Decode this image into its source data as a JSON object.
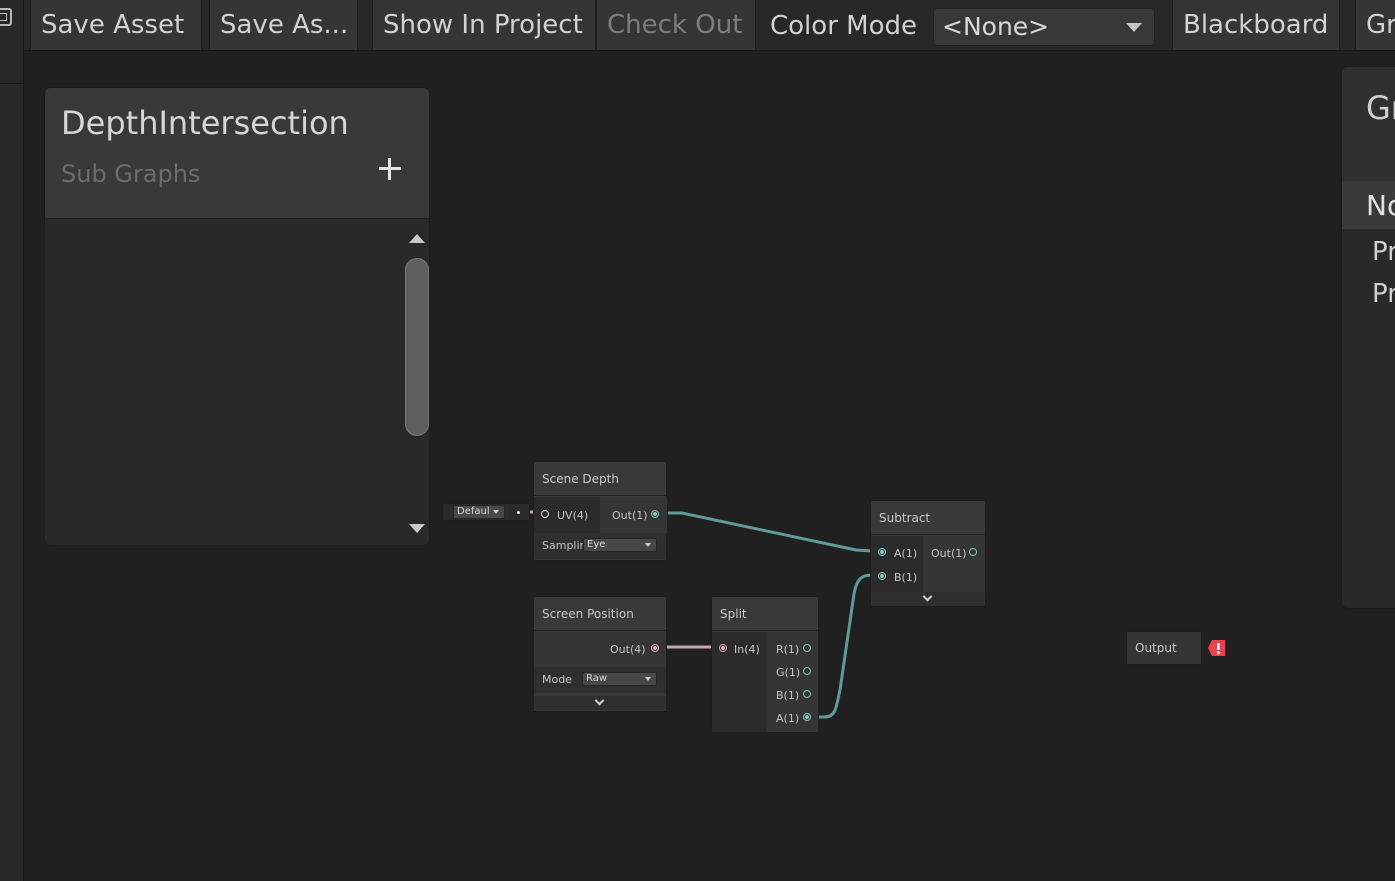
{
  "toolbar": {
    "save_asset": "Save Asset",
    "save_as": "Save As...",
    "show_in_project": "Show In Project",
    "check_out": "Check Out",
    "color_mode_label": "Color Mode",
    "color_mode_value": "<None>",
    "blackboard": "Blackboard",
    "graph_inspector": "Gr"
  },
  "blackboard": {
    "title": "DepthIntersection",
    "subtitle": "Sub Graphs"
  },
  "inspector": {
    "title": "Gr",
    "tab": "No",
    "items": [
      "Pr",
      "Pr"
    ]
  },
  "nodes": {
    "scene_depth": {
      "title": "Scene Depth",
      "input": "UV(4)",
      "output": "Out(1)",
      "option_label": "Samplin",
      "option_value": "Eye",
      "default_value": "Defaul"
    },
    "screen_position": {
      "title": "Screen Position",
      "output": "Out(4)",
      "option_label": "Mode",
      "option_value": "Raw"
    },
    "split": {
      "title": "Split",
      "input": "In(4)",
      "outputs": [
        "R(1)",
        "G(1)",
        "B(1)",
        "A(1)"
      ]
    },
    "subtract": {
      "title": "Subtract",
      "inputs": [
        "A(1)",
        "B(1)"
      ],
      "output": "Out(1)"
    },
    "output": {
      "title": "Output"
    }
  },
  "colors": {
    "float_wire": "#5f9b99",
    "vector4_wire": "#c8a3b3",
    "warning": "#e8434f"
  }
}
